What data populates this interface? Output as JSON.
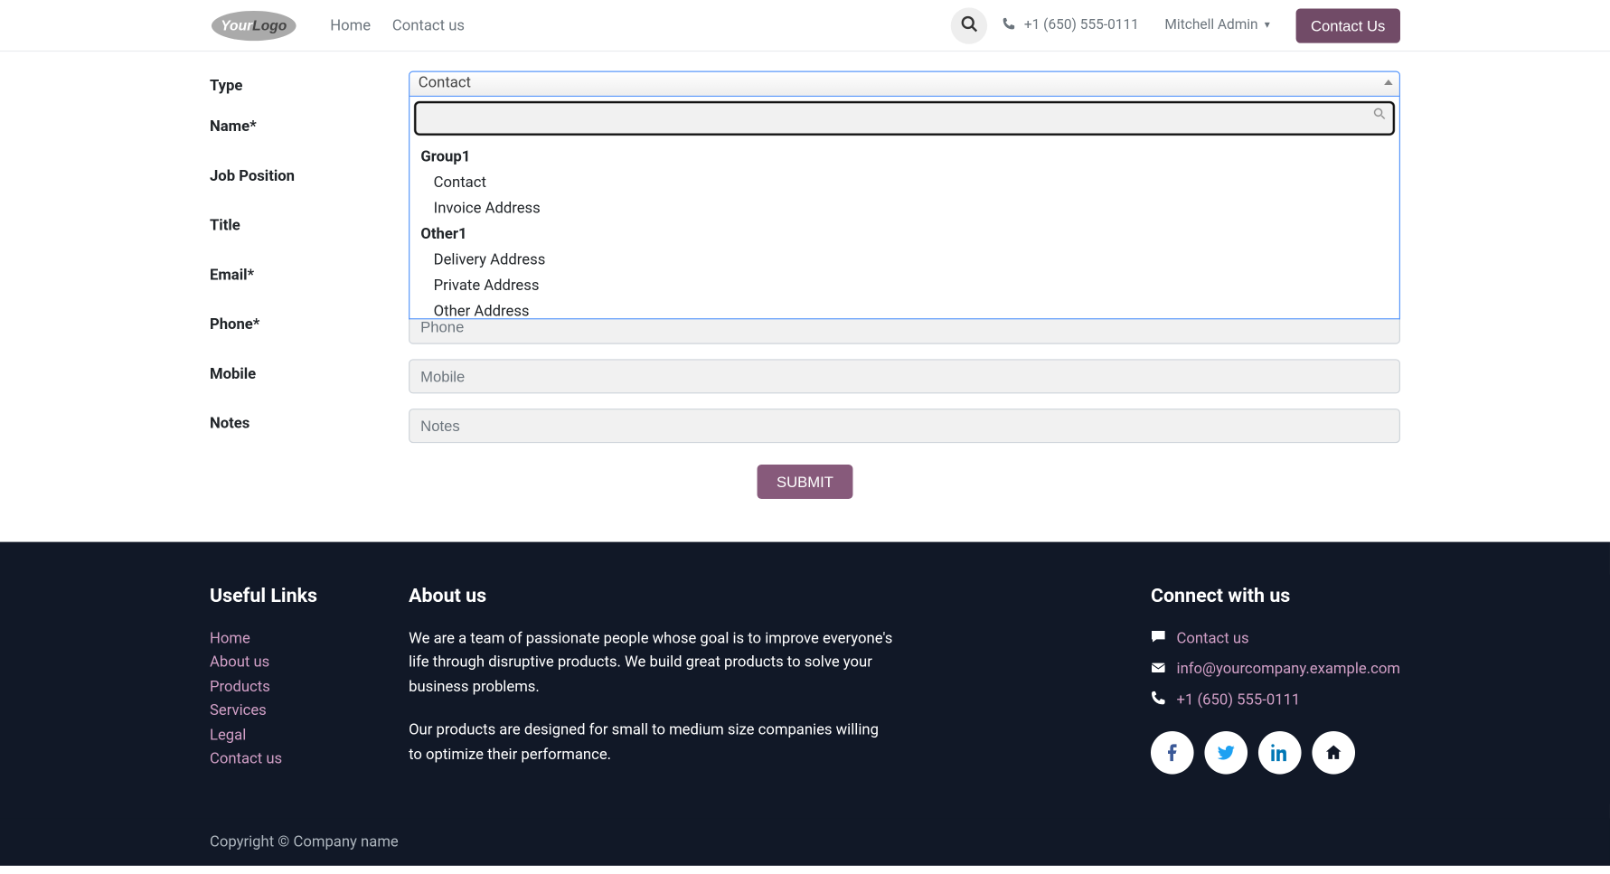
{
  "nav": {
    "home": "Home",
    "contact_us": "Contact us",
    "phone": "+1 (650) 555-0111",
    "user": "Mitchell Admin",
    "contact_btn": "Contact Us"
  },
  "form": {
    "labels": {
      "type": "Type",
      "name": "Name*",
      "job": "Job Position",
      "title": "Title",
      "email": "Email*",
      "phone": "Phone*",
      "mobile": "Mobile",
      "notes": "Notes"
    },
    "placeholders": {
      "phone": "Phone",
      "mobile": "Mobile",
      "notes": "Notes"
    },
    "type_selected": "Contact",
    "type_search_value": "",
    "type_groups": [
      {
        "label": "Group1",
        "options": [
          "Contact",
          "Invoice Address"
        ]
      },
      {
        "label": "Other1",
        "options": [
          "Delivery Address",
          "Private Address",
          "Other Address"
        ]
      }
    ],
    "submit": "SUBMIT"
  },
  "footer": {
    "useful_links_h": "Useful Links",
    "useful_links": [
      "Home",
      "About us",
      "Products",
      "Services",
      "Legal",
      "Contact us"
    ],
    "about_h": "About us",
    "about_p1": "We are a team of passionate people whose goal is to improve everyone's life through disruptive products. We build great products to solve your business problems.",
    "about_p2": "Our products are designed for small to medium size companies willing to optimize their performance.",
    "connect_h": "Connect with us",
    "connect_contact": "Contact us",
    "connect_email": "info@yourcompany.example.com",
    "connect_phone": "+1 (650) 555-0111",
    "copyright": "Copyright © Company name"
  }
}
